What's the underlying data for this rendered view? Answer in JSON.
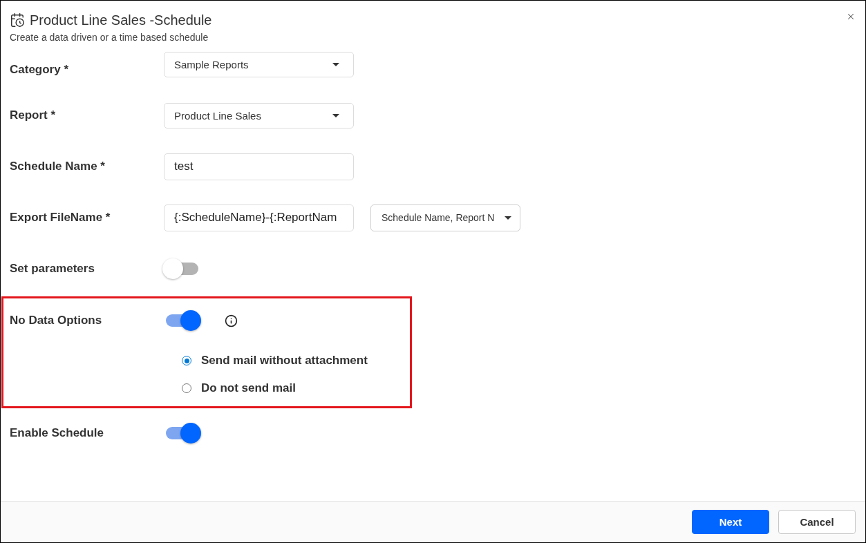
{
  "dialog": {
    "title": "Product Line Sales -Schedule",
    "subtitle": "Create a data driven or a time based schedule"
  },
  "form": {
    "rows": [
      {
        "kind": "select",
        "label": "Category *",
        "value": "Sample Reports"
      },
      {
        "kind": "select",
        "label": "Report *",
        "value": "Product Line Sales"
      },
      {
        "kind": "text",
        "label": "Schedule Name *",
        "value": "test"
      },
      {
        "kind": "text_with_menu",
        "label": "Export FileName *",
        "value": "{:ScheduleName}-{:ReportNam",
        "menu": "Schedule Name, Report N"
      },
      {
        "kind": "toggle",
        "label": "Set parameters",
        "on": false
      },
      {
        "kind": "toggle",
        "label": "No Data Options",
        "on": true,
        "info": true,
        "highlighted": true,
        "options": [
          {
            "label": "Send mail without attachment",
            "selected": true
          },
          {
            "label": "Do not send mail",
            "selected": false
          }
        ]
      },
      {
        "kind": "toggle",
        "label": "Enable Schedule",
        "on": true
      }
    ]
  },
  "footer": {
    "buttons": [
      {
        "kind": "primary",
        "label": "Next"
      },
      {
        "kind": "secondary",
        "label": "Cancel"
      }
    ]
  }
}
